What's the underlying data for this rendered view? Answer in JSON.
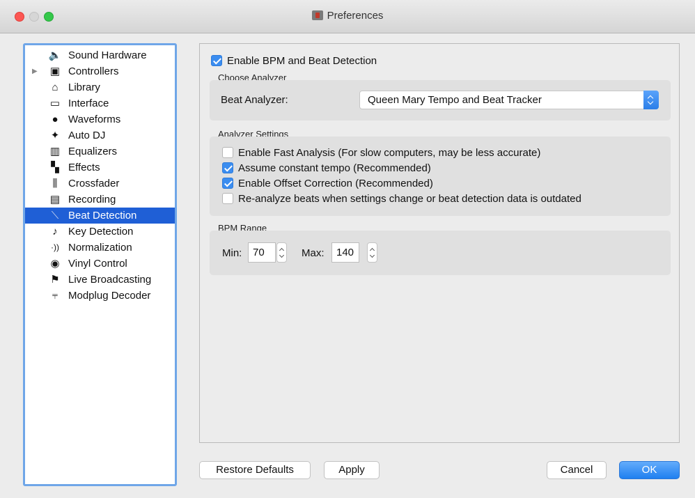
{
  "window": {
    "title": "Preferences"
  },
  "sidebar": {
    "items": [
      {
        "label": "Sound Hardware",
        "icon": "speaker-icon",
        "glyph": "🔈"
      },
      {
        "label": "Controllers",
        "icon": "controller-icon",
        "glyph": "▣",
        "expandable": true
      },
      {
        "label": "Library",
        "icon": "library-icon",
        "glyph": "🏛"
      },
      {
        "label": "Interface",
        "icon": "monitor-icon",
        "glyph": "🖵"
      },
      {
        "label": "Waveforms",
        "icon": "waveform-icon",
        "glyph": "⦿"
      },
      {
        "label": "Auto DJ",
        "icon": "robot-icon",
        "glyph": "✦"
      },
      {
        "label": "Equalizers",
        "icon": "equalizer-icon",
        "glyph": "▥"
      },
      {
        "label": "Effects",
        "icon": "effects-icon",
        "glyph": "▚"
      },
      {
        "label": "Crossfader",
        "icon": "crossfader-icon",
        "glyph": "⫼"
      },
      {
        "label": "Recording",
        "icon": "recording-icon",
        "glyph": "▤"
      },
      {
        "label": "Beat Detection",
        "icon": "beat-detection-icon",
        "glyph": "⟍",
        "selected": true
      },
      {
        "label": "Key Detection",
        "icon": "key-detection-icon",
        "glyph": "♪"
      },
      {
        "label": "Normalization",
        "icon": "normalization-icon",
        "glyph": "·))"
      },
      {
        "label": "Vinyl Control",
        "icon": "vinyl-icon",
        "glyph": "◉"
      },
      {
        "label": "Live Broadcasting",
        "icon": "broadcast-icon",
        "glyph": "⚑"
      },
      {
        "label": "Modplug Decoder",
        "icon": "modplug-icon",
        "glyph": "⫧"
      }
    ]
  },
  "main": {
    "enable_bpm": {
      "label": "Enable BPM and Beat Detection",
      "checked": true
    },
    "choose_analyzer": {
      "title": "Choose Analyzer",
      "label": "Beat Analyzer:",
      "value": "Queen Mary Tempo and Beat Tracker"
    },
    "analyzer_settings": {
      "title": "Analyzer Settings",
      "options": [
        {
          "label": "Enable Fast Analysis (For slow computers, may be less accurate)",
          "checked": false
        },
        {
          "label": "Assume constant tempo (Recommended)",
          "checked": true
        },
        {
          "label": "Enable Offset Correction (Recommended)",
          "checked": true
        },
        {
          "label": "Re-analyze beats when settings change or beat detection data is outdated",
          "checked": false
        }
      ]
    },
    "bpm_range": {
      "title": "BPM Range",
      "min_label": "Min:",
      "min_value": "70",
      "max_label": "Max:",
      "max_value": "140"
    }
  },
  "buttons": {
    "restore_defaults": "Restore Defaults",
    "apply": "Apply",
    "cancel": "Cancel",
    "ok": "OK"
  },
  "colors": {
    "selection": "#1f5fd6",
    "focus_ring": "#6fa6e8",
    "accent": "#3b8df0"
  }
}
